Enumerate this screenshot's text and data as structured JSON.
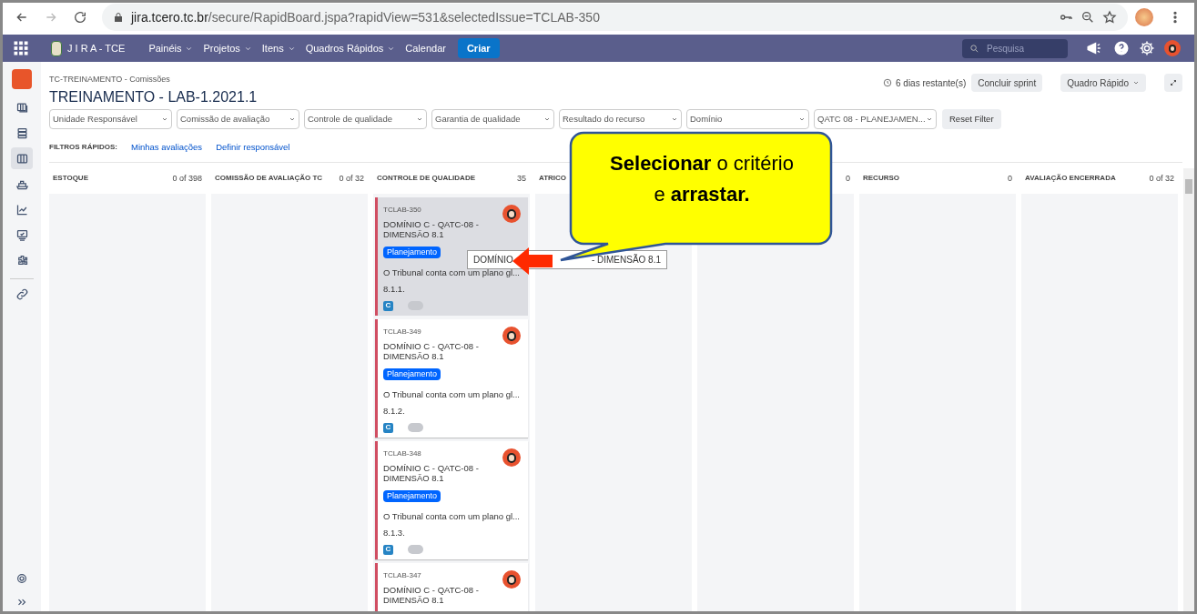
{
  "browser": {
    "url_host": "jira.tcero.tc.br",
    "url_path": "/secure/RapidBoard.jspa?rapidView=531&selectedIssue=TCLAB-350"
  },
  "navbar": {
    "logo": "J I R A - TCE",
    "menus": [
      {
        "label": "Painéis",
        "dropdown": true
      },
      {
        "label": "Projetos",
        "dropdown": true
      },
      {
        "label": "Itens",
        "dropdown": true
      },
      {
        "label": "Quadros Rápidos",
        "dropdown": true
      },
      {
        "label": "Calendar",
        "dropdown": false
      }
    ],
    "create": "Criar",
    "search": {
      "placeholder": "Pesquisa"
    }
  },
  "sidebar": {
    "items": [
      {
        "selected": false
      },
      {
        "selected": false
      },
      {
        "selected": true
      },
      {
        "selected": false
      },
      {
        "selected": false
      },
      {
        "selected": false
      },
      {
        "selected": false
      },
      {
        "selected": false
      }
    ]
  },
  "header": {
    "breadcrumb": "TC-TREINAMENTO - Comissões",
    "title": "TREINAMENTO - LAB-1.2021.1",
    "remaining": "6 dias restante(s)",
    "complete": "Concluir sprint",
    "board_menu": "Quadro Rápido"
  },
  "filters": [
    "Unidade Responsável",
    "Comissão de avaliação",
    "Controle de qualidade",
    "Garantia de qualidade",
    "Resultado do recurso",
    "Domínio",
    "QATC 08 - PLANEJAMEN..."
  ],
  "reset": "Reset Filter",
  "quick_filters": {
    "label": "FILTROS RÁPIDOS:",
    "links": [
      "Minhas avaliações",
      "Definir responsável"
    ]
  },
  "columns": [
    {
      "name": "ESTOQUE",
      "count": "0 of 398"
    },
    {
      "name": "COMISSÃO DE AVALIAÇÃO TC",
      "count": "0 of 32"
    },
    {
      "name": "CONTROLE DE QUALIDADE",
      "count": "35"
    },
    {
      "name": "ATRICO"
    },
    {
      "count": "0"
    },
    {
      "name": "RECURSO",
      "count": "0"
    },
    {
      "name": "AVALIAÇÃO ENCERRADA",
      "count": "0 of 32"
    }
  ],
  "cards": [
    {
      "key": "TCLAB-350",
      "title": "DOMÍNIO C - QATC-08 - DIMENSÃO 8.1",
      "tag": "Planejamento",
      "summary": "O Tribunal conta com um plano gl...",
      "number": "8.1.1.",
      "type": "C",
      "selected": true
    },
    {
      "key": "TCLAB-349",
      "title": "DOMÍNIO C - QATC-08 - DIMENSÃO 8.1",
      "tag": "Planejamento",
      "summary": "O Tribunal conta com um plano gl...",
      "number": "8.1.2.",
      "type": "C",
      "selected": false
    },
    {
      "key": "TCLAB-348",
      "title": "DOMÍNIO C - QATC-08 - DIMENSÃO 8.1",
      "tag": "Planejamento",
      "summary": "O Tribunal conta com um plano gl...",
      "number": "8.1.3.",
      "type": "C",
      "selected": false
    },
    {
      "key": "TCLAB-347",
      "title": "DOMÍNIO C - QATC-08 - DIMENSÃO 8.1",
      "selected": false
    }
  ],
  "tooltip": {
    "before": "DOMÍNIO",
    "after": "- DIMENSÃO 8.1"
  },
  "callout": "**Selecionar** o critério e **arrastar.**"
}
